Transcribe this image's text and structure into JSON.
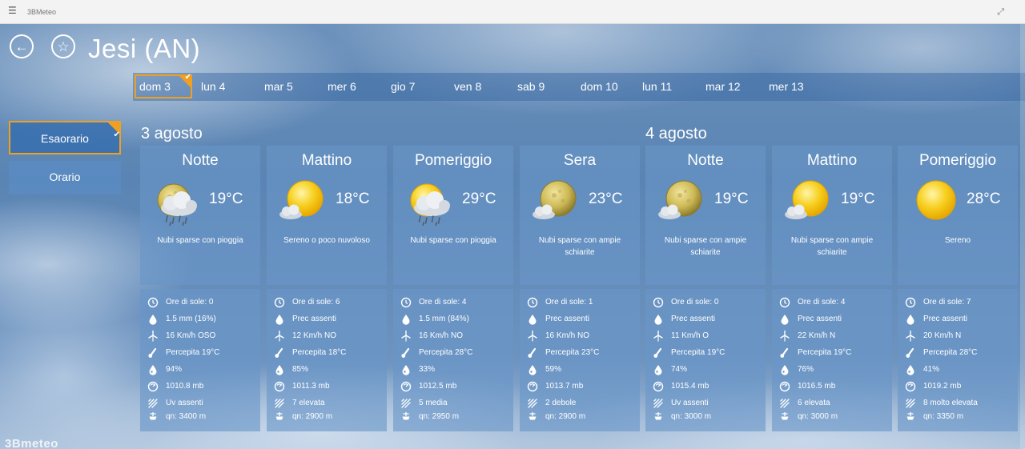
{
  "window": {
    "title": "3BMeteo"
  },
  "header": {
    "city": "Jesi (AN)"
  },
  "days": [
    {
      "label": "dom 3",
      "selected": true
    },
    {
      "label": "lun 4"
    },
    {
      "label": "mar 5"
    },
    {
      "label": "mer 6"
    },
    {
      "label": "gio 7"
    },
    {
      "label": "ven 8"
    },
    {
      "label": "sab 9"
    },
    {
      "label": "dom 10"
    },
    {
      "label": "lun 11"
    },
    {
      "label": "mar 12"
    },
    {
      "label": "mer 13"
    }
  ],
  "views": {
    "esaorario": "Esaorario",
    "orario": "Orario",
    "active": "esaorario"
  },
  "dates": [
    "3 agosto",
    "4 agosto"
  ],
  "logo": "3Bmeteo",
  "cards": [
    {
      "period": "Notte",
      "temp": "19°C",
      "icon": "moon-cloud-rain-icon",
      "desc": "Nubi sparse con pioggia",
      "sun": "Ore di sole: 0",
      "rain": "1.5 mm (16%)",
      "wind": "16 Km/h OSO",
      "felt": "Percepita 19°C",
      "humidity": "94%",
      "pressure": "1010.8 mb",
      "uv": "Uv assenti",
      "freezing": "qn: 3400 m"
    },
    {
      "period": "Mattino",
      "temp": "18°C",
      "icon": "sun-small-cloud-icon",
      "desc": "Sereno o poco nuvoloso",
      "sun": "Ore di sole: 6",
      "rain": "Prec assenti",
      "wind": "12 Km/h NO",
      "felt": "Percepita 18°C",
      "humidity": "85%",
      "pressure": "1011.3 mb",
      "uv": "7 elevata",
      "freezing": "qn: 2900 m"
    },
    {
      "period": "Pomeriggio",
      "temp": "29°C",
      "icon": "sun-cloud-rain-icon",
      "desc": "Nubi sparse con pioggia",
      "sun": "Ore di sole: 4",
      "rain": "1.5 mm (84%)",
      "wind": "16 Km/h NO",
      "felt": "Percepita 28°C",
      "humidity": "33%",
      "pressure": "1012.5 mb",
      "uv": "5 media",
      "freezing": "qn: 2950 m"
    },
    {
      "period": "Sera",
      "temp": "23°C",
      "icon": "moon-small-cloud-icon",
      "desc": "Nubi sparse con ampie schiarite",
      "sun": "Ore di sole: 1",
      "rain": "Prec assenti",
      "wind": "16 Km/h NO",
      "felt": "Percepita 23°C",
      "humidity": "59%",
      "pressure": "1013.7 mb",
      "uv": "2 debole",
      "freezing": "qn: 2900 m"
    },
    {
      "period": "Notte",
      "temp": "19°C",
      "icon": "moon-small-cloud-icon",
      "desc": "Nubi sparse con ampie schiarite",
      "sun": "Ore di sole: 0",
      "rain": "Prec assenti",
      "wind": "11 Km/h O",
      "felt": "Percepita 19°C",
      "humidity": "74%",
      "pressure": "1015.4 mb",
      "uv": "Uv assenti",
      "freezing": "qn: 3000 m"
    },
    {
      "period": "Mattino",
      "temp": "19°C",
      "icon": "sun-small-cloud-icon",
      "desc": "Nubi sparse con ampie schiarite",
      "sun": "Ore di sole: 4",
      "rain": "Prec assenti",
      "wind": "22 Km/h N",
      "felt": "Percepita 19°C",
      "humidity": "76%",
      "pressure": "1016.5 mb",
      "uv": "6 elevata",
      "freezing": "qn: 3000 m"
    },
    {
      "period": "Pomeriggio",
      "temp": "28°C",
      "icon": "sun-icon",
      "desc": "Sereno",
      "sun": "Ore di sole: 7",
      "rain": "Prec assenti",
      "wind": "20 Km/h N",
      "felt": "Percepita 28°C",
      "humidity": "41%",
      "pressure": "1019.2 mb",
      "uv": "8 molto elevata",
      "freezing": "qn: 3350 m"
    }
  ],
  "colors": {
    "accent": "#f0a020",
    "sun": "#f5c518",
    "moon": "#d9c46a"
  }
}
